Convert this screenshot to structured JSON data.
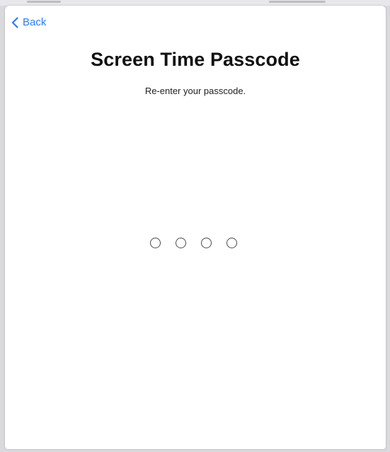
{
  "nav": {
    "back_label": "Back",
    "back_icon": "chevron-left-icon",
    "accent_color": "#2f7cf6"
  },
  "header": {
    "title": "Screen Time Passcode",
    "subtitle": "Re-enter your passcode."
  },
  "passcode": {
    "length": 4,
    "entered": 0
  }
}
